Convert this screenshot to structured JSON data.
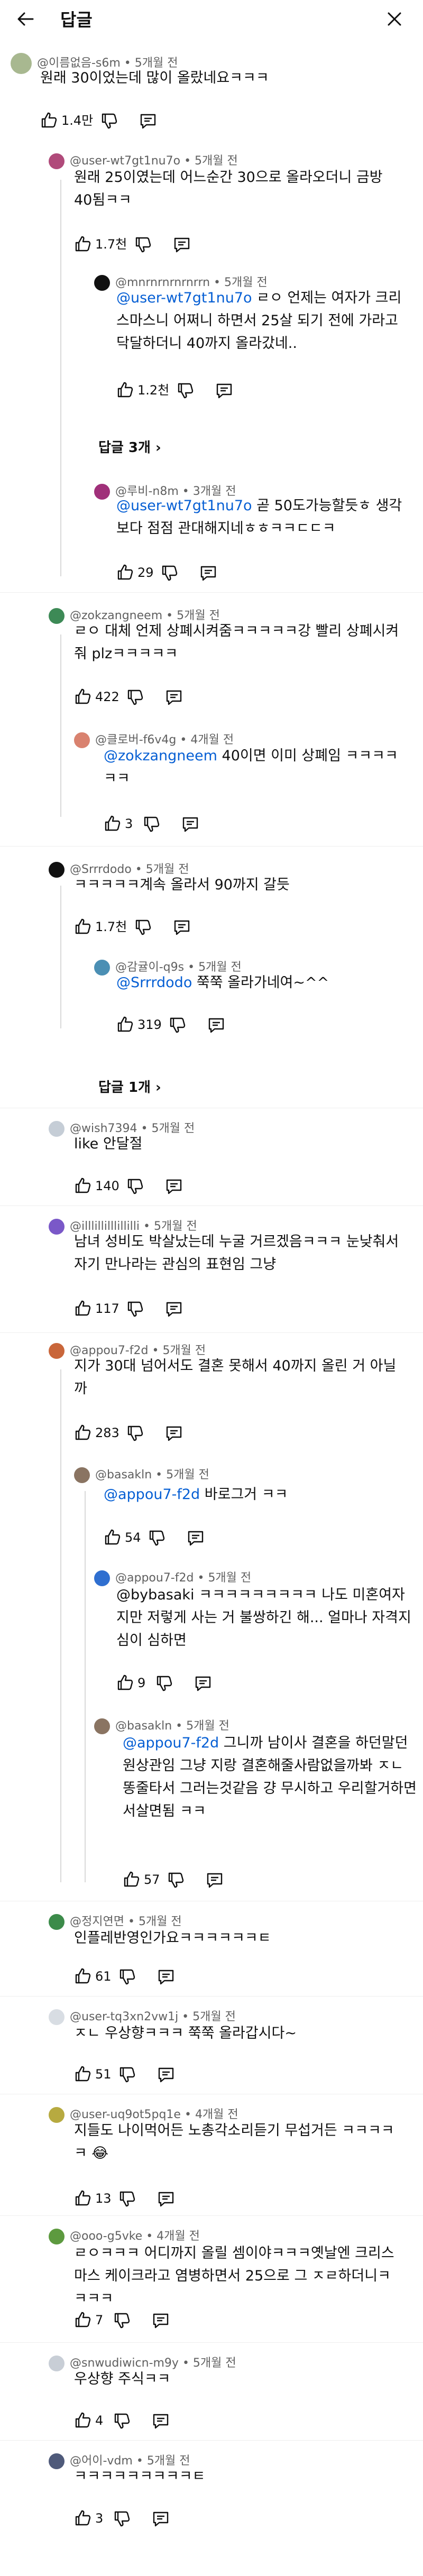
{
  "header": {
    "title": "답글"
  },
  "comments": [
    {
      "author": "@이름없음-s6m",
      "time": "5개월 전",
      "text": "원래 30이었는데 많이 올랐네요ㅋㅋㅋ",
      "likes": "1.4만"
    },
    {
      "author": "@user-wt7gt1nu7o",
      "time": "5개월 전",
      "text": "원래 25이였는데 어느순간 30으로 올라오더니 금방 40됨ㅋㅋ",
      "likes": "1.7천"
    },
    {
      "author": "@mnrnrnrnrnrrn",
      "time": "5개월 전",
      "mention": "@user-wt7gt1nu7o",
      "text": " ㄹㅇ 언제는 여자가 크리스마스니 어쩌니 하면서 25살 되기 전에 가라고 닥달하더니 40까지 올라갔네..",
      "likes": "1.2천",
      "more_replies": "답글 3개"
    },
    {
      "author": "@루비-n8m",
      "time": "3개월 전",
      "mention": "@user-wt7gt1nu7o",
      "text": " 곧 50도가능할듯ㅎ 생각보다 점점 관대해지네ㅎㅎㅋㅋㄷㄷㅋ",
      "likes": "29"
    },
    {
      "author": "@zokzangneem",
      "time": "5개월 전",
      "text": "ㄹㅇ 대체 언제 상폐시켜줌ㅋㅋㅋㅋㅋ강 빨리 상폐시켜줘 plzㅋㅋㅋㅋㅋ",
      "likes": "422"
    },
    {
      "author": "@클로버-f6v4g",
      "time": "4개월 전",
      "mention": "@zokzangneem",
      "text": "  40이면 이미 상폐임 ㅋㅋㅋㅋㅋㅋ",
      "likes": "3"
    },
    {
      "author": "@Srrrdodo",
      "time": "5개월 전",
      "text": "ㅋㅋㅋㅋㅋ계속 올라서 90까지 갈듯",
      "likes": "1.7천"
    },
    {
      "author": "@감귤이-q9s",
      "time": "5개월 전",
      "mention": "@Srrrdodo",
      "text": " 쭉쭉 올라가네여~^^",
      "likes": "319",
      "more_replies": "답글 1개"
    },
    {
      "author": "@wish7394",
      "time": "5개월 전",
      "text": "like 안달절",
      "likes": "140"
    },
    {
      "author": "@illlillilllillilli",
      "time": "5개월 전",
      "text": "남녀 성비도 박살났는데 누굴 거르겠음ㅋㅋㅋ 눈낮춰서 자기 만나라는 관심의 표현임 그냥",
      "likes": "117"
    },
    {
      "author": "@appou7-f2d",
      "time": "5개월 전",
      "text": "지가 30대 넘어서도 결혼 못해서 40까지 올린 거 아닐까",
      "likes": "283"
    },
    {
      "author": "@basakln",
      "time": "5개월 전",
      "mention": "@appou7-f2d",
      "text": " 바로그거 ㅋㅋ",
      "likes": "54"
    },
    {
      "author": "@appou7-f2d",
      "time": "5개월 전",
      "text": "@bybasaki ㅋㅋㅋㅋㅋㅋㅋㅋㅋ 나도 미혼여자지만 저렇게 사는 거 불쌍하긴 해... 얼마나 자격지심이 심하면",
      "likes": "9"
    },
    {
      "author": "@basakln",
      "time": "5개월 전",
      "mention": "@appou7-f2d",
      "text": " 그니까 남이사 결혼을 하던말던 원상관임 그냥 지랑 결혼해줄사람없을까봐 ㅈㄴ 똥줄타서 그러는것같음 걍 무시하고 우리할거하면서살면됨 ㅋㅋ",
      "likes": "57"
    },
    {
      "author": "@정지연면",
      "time": "5개월 전",
      "text": "인플레반영인가요ㅋㅋㅋㅋㅋㅋㅌ",
      "likes": "61"
    },
    {
      "author": "@user-tq3xn2vw1j",
      "time": "5개월 전",
      "text": "ㅈㄴ 우상향ㅋㅋㅋ 쭉쭉 올라갑시다~",
      "likes": "51"
    },
    {
      "author": "@user-uq9ot5pq1e",
      "time": "4개월 전",
      "text": "지들도 나이먹어든 노총각소리듣기 무섭거든 ㅋㅋㅋㅋㅋ 😂",
      "likes": "13"
    },
    {
      "author": "@ooo-g5vke",
      "time": "4개월 전",
      "text": "ㄹㅇㅋㅋㅋ 어디까지 올릴 셈이야ㅋㅋㅋ옛날엔 크리스마스 케이크라고 염병하면서 25으로 그 ㅈㄹ하더니ㅋㅋㅋㅋ",
      "likes": "7"
    },
    {
      "author": "@snwudiwicn-m9y",
      "time": "5개월 전",
      "text": "우상향 주식ㅋㅋ",
      "likes": "4"
    },
    {
      "author": "@어이-vdm",
      "time": "5개월 전",
      "text": "ㅋㅋㅋㅋㅋㅋㅋㅋㅋㅌ",
      "likes": "3"
    }
  ],
  "colors": {
    "mention": "#065fd4",
    "meta": "#606060",
    "text": "#0f0f0f"
  }
}
